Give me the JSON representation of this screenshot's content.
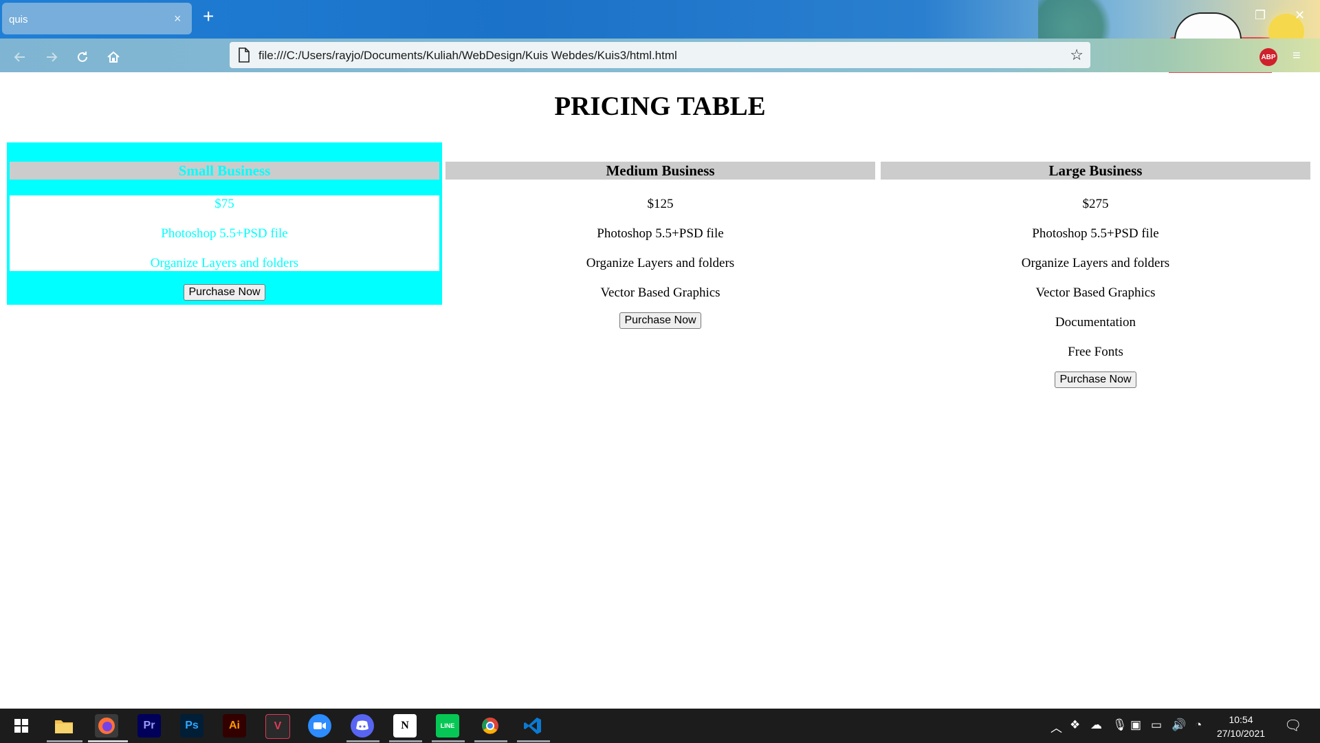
{
  "browser": {
    "tab_title": "quis",
    "tab_close": "×",
    "new_tab": "+",
    "url": "file:///C:/Users/rayjo/Documents/Kuliah/WebDesign/Kuis Webdes/Kuis3/html.html",
    "abp_badge": "ABP"
  },
  "page": {
    "title": "PRICING TABLE",
    "plans": [
      {
        "name": "Small Business",
        "price": "$75",
        "features": [
          "Photoshop 5.5+PSD file",
          "Organize Layers and folders"
        ],
        "button": "Purchase Now",
        "highlighted": true
      },
      {
        "name": "Medium Business",
        "price": "$125",
        "features": [
          "Photoshop 5.5+PSD file",
          "Organize Layers and folders",
          "Vector Based Graphics"
        ],
        "button": "Purchase Now",
        "highlighted": false
      },
      {
        "name": "Large Business",
        "price": "$275",
        "features": [
          "Photoshop 5.5+PSD file",
          "Organize Layers and folders",
          "Vector Based Graphics",
          "Documentation",
          "Free Fonts"
        ],
        "button": "Purchase Now",
        "highlighted": false
      }
    ],
    "colors": {
      "highlight": "#00ffff",
      "header_bg": "#cccccc"
    }
  },
  "taskbar": {
    "apps": [
      {
        "name": "windows-start-icon",
        "label": ""
      },
      {
        "name": "file-explorer-icon",
        "label": ""
      },
      {
        "name": "firefox-icon",
        "label": ""
      },
      {
        "name": "premiere-pro-icon",
        "label": "Pr"
      },
      {
        "name": "photoshop-icon",
        "label": "Ps"
      },
      {
        "name": "illustrator-icon",
        "label": "Ai"
      },
      {
        "name": "vectorian-icon",
        "label": "V"
      },
      {
        "name": "zoom-icon",
        "label": ""
      },
      {
        "name": "discord-icon",
        "label": ""
      },
      {
        "name": "notion-icon",
        "label": "N"
      },
      {
        "name": "line-icon",
        "label": "LINE"
      },
      {
        "name": "chrome-icon",
        "label": ""
      },
      {
        "name": "vscode-icon",
        "label": ""
      }
    ],
    "time": "10:54",
    "date": "27/10/2021"
  }
}
